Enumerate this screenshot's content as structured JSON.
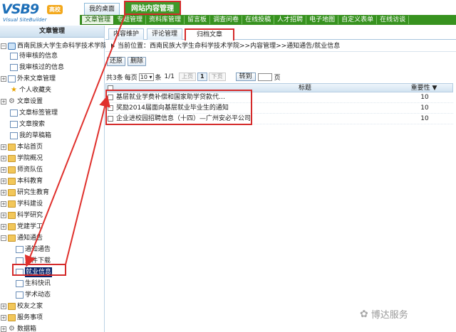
{
  "logo": {
    "main": "VSB9",
    "badge": "高校",
    "sub": "Visual SiteBuilder"
  },
  "top_tabs": {
    "desktop": "我的桌面",
    "site_content": "网站内容管理"
  },
  "nav": [
    "文章管理",
    "专题管理",
    "资料库管理",
    "留言板",
    "调查问卷",
    "在线投稿",
    "人才招聘",
    "电子地图",
    "自定义表单",
    "在线访谈"
  ],
  "sidebar": {
    "title": "文章管理",
    "root": "西南民族大学生命科学技术学院",
    "items": [
      "待审核的信息",
      "我审核过的信息",
      "外来文章管理",
      "个人收藏夹",
      "文章设置",
      "文章标签管理",
      "文章搜索",
      "我的草稿箱",
      "本站首页",
      "学院概况",
      "师资队伍",
      "本科教育",
      "研究生教育",
      "学科建设",
      "科学研究",
      "党建学工",
      "通知通告",
      "通知通告",
      "文件下载",
      "就业信息",
      "生科快讯",
      "学术动态",
      "校友之家",
      "服务事项",
      "数据箱"
    ]
  },
  "main_tabs": [
    "内容维护",
    "评论管理",
    "归档文章"
  ],
  "breadcrumb": "当前位置：西南民族大学生命科学技术学院>>内容管理>>通知通告/就业信息",
  "toolbar": {
    "restore": "还原",
    "delete": "删除"
  },
  "pager": {
    "total_prefix": "共3条",
    "per_page_label": "每页",
    "per_page_value": "10 ▾",
    "per_page_suffix": "条",
    "page_info": "1/1",
    "prev": "上页",
    "current": "1",
    "next": "下页",
    "goto": "转到",
    "page_suffix": "页"
  },
  "grid": {
    "headers": {
      "title": "标题",
      "importance": "重要性 ▼"
    },
    "rows": [
      {
        "title": "基层就业学费补偿和国家助学贷款代…",
        "importance": "10"
      },
      {
        "title": "奖励2014届面向基层就业毕业生的通知",
        "importance": "10"
      },
      {
        "title": "企业进校园招聘信息（十四）—广州安必平公司",
        "importance": "10"
      }
    ]
  },
  "watermark": {
    "text": "博达服务"
  }
}
